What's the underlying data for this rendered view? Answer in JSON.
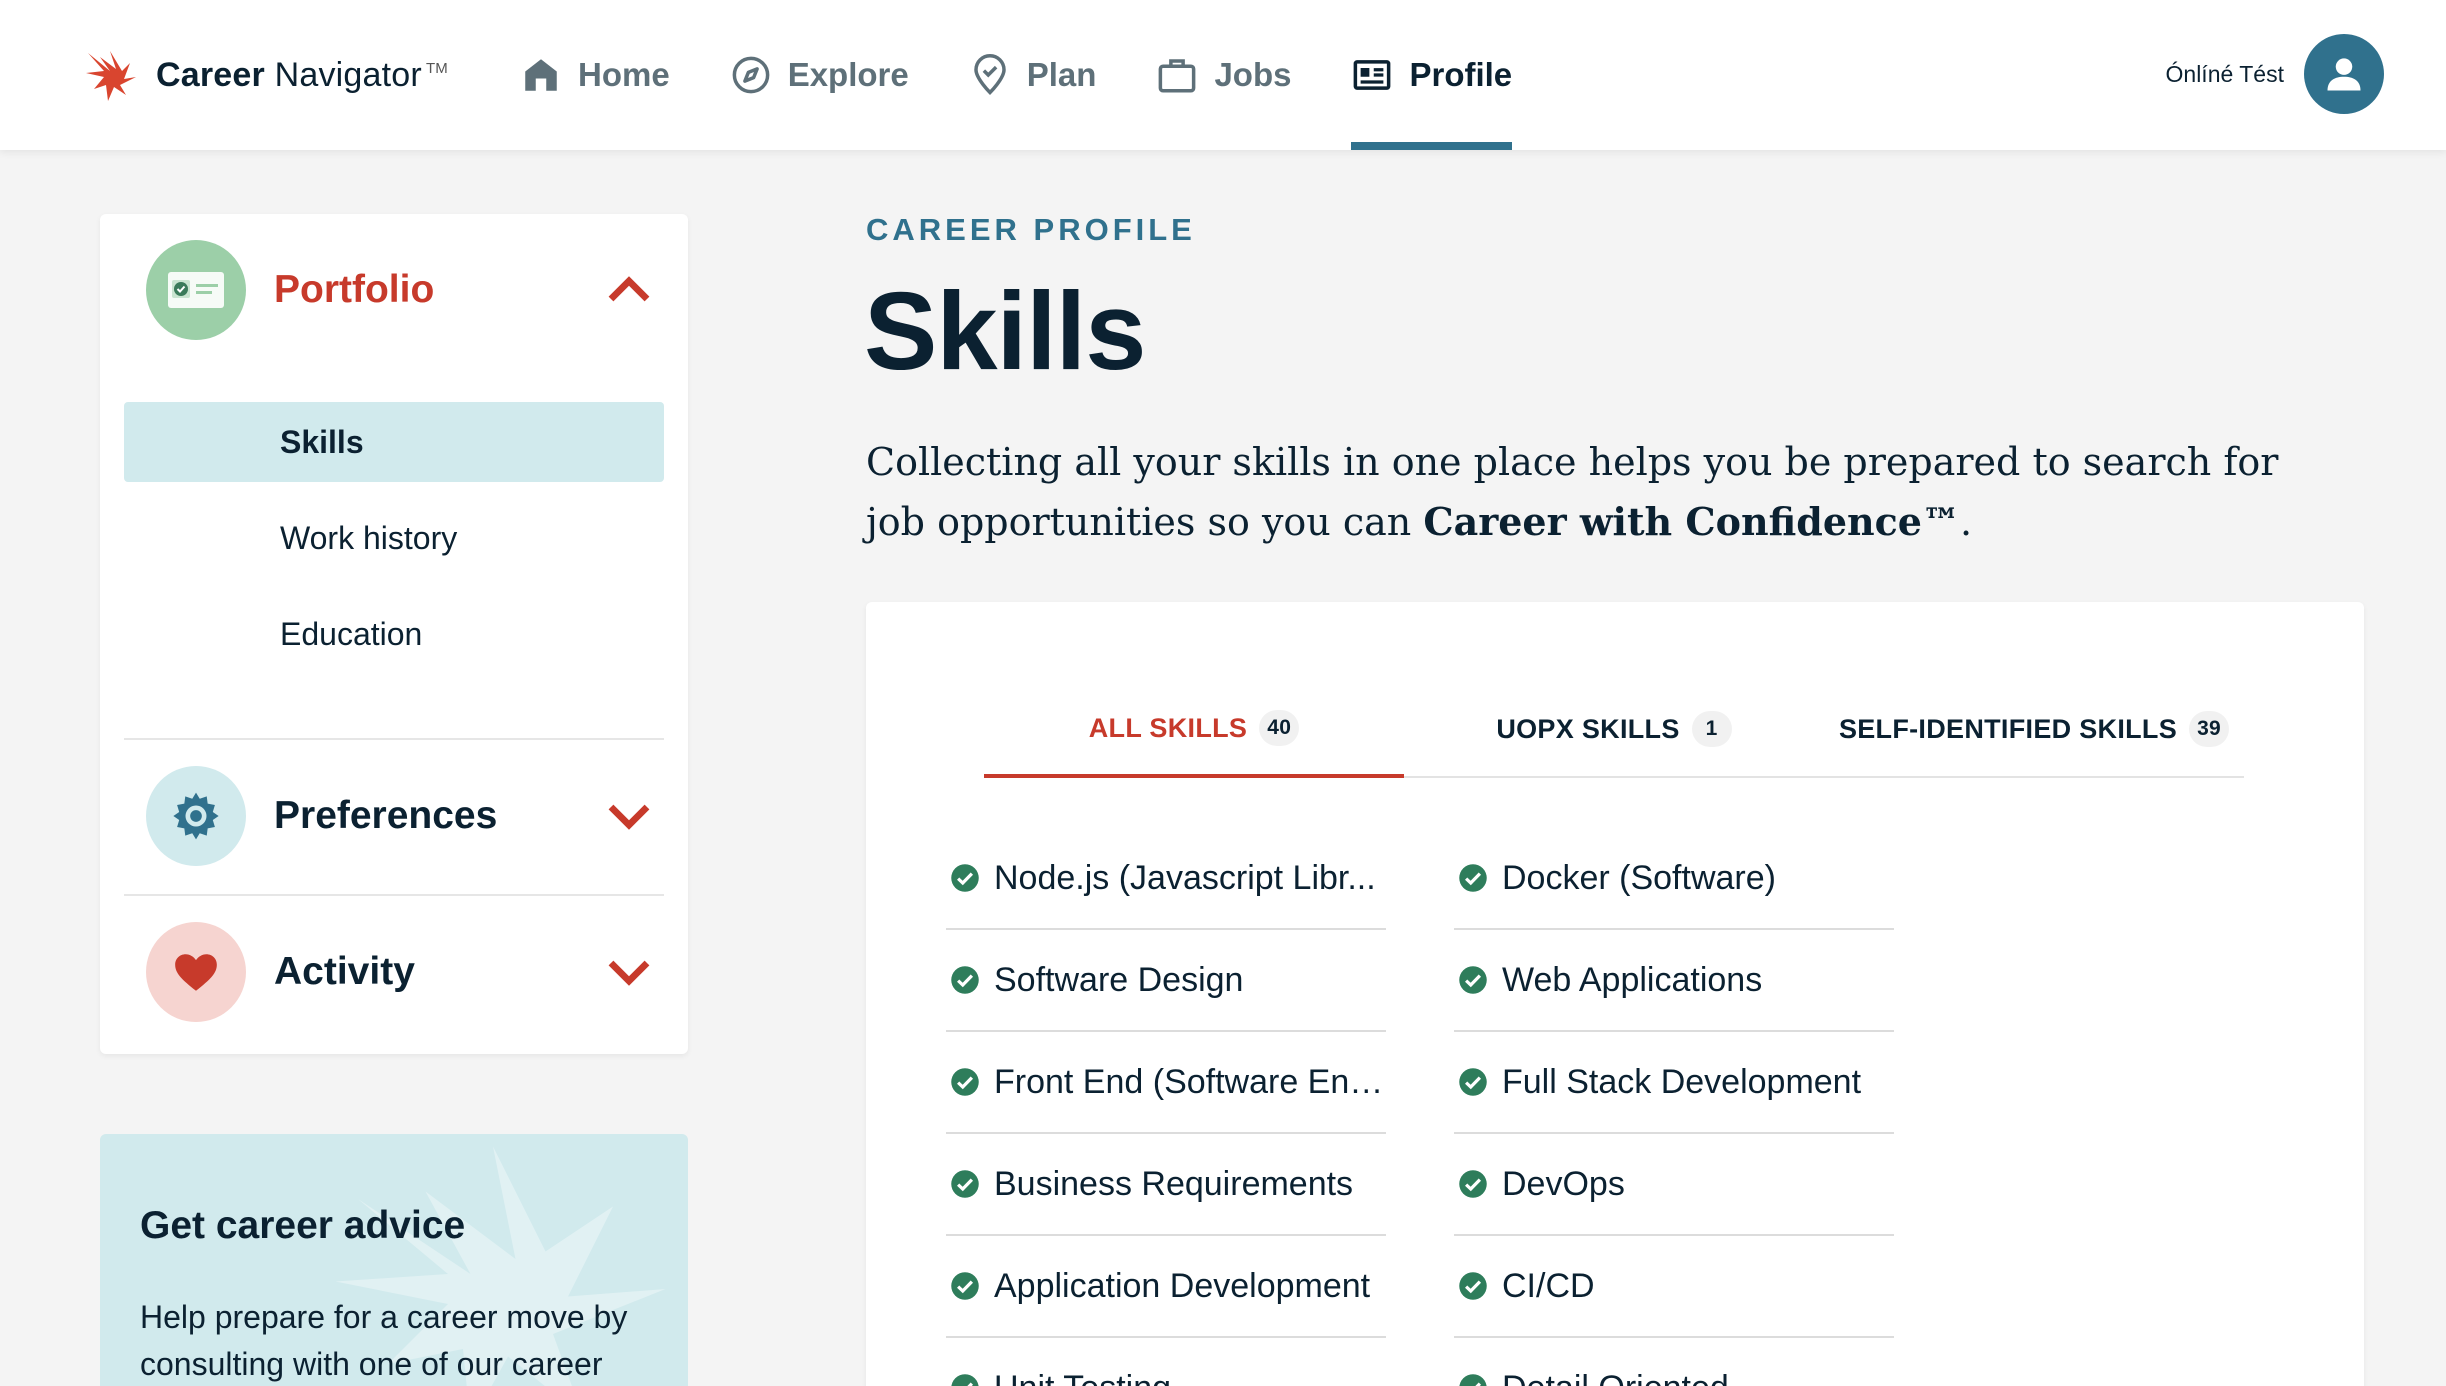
{
  "header": {
    "brand_bold": "Career",
    "brand_rest": "Navigator",
    "brand_tm": "TM",
    "nav": [
      {
        "label": "Home",
        "icon": "home-icon"
      },
      {
        "label": "Explore",
        "icon": "compass-icon"
      },
      {
        "label": "Plan",
        "icon": "map-pin-check-icon"
      },
      {
        "label": "Jobs",
        "icon": "briefcase-icon"
      },
      {
        "label": "Profile",
        "icon": "id-card-icon"
      }
    ],
    "active_nav": "Profile",
    "user_name": "Ónlíné Tést"
  },
  "sidebar": {
    "portfolio": {
      "title": "Portfolio",
      "items": [
        "Skills",
        "Work history",
        "Education"
      ],
      "active_item": "Skills"
    },
    "preferences": {
      "title": "Preferences"
    },
    "activity": {
      "title": "Activity"
    },
    "advice": {
      "title": "Get career advice",
      "text": "Help prepare for a career move by consulting with one of our career"
    }
  },
  "main": {
    "eyebrow": "CAREER PROFILE",
    "title": "Skills",
    "intro_plain": "Collecting all your skills in one place helps you be prepared to search for job opportunities so you can ",
    "intro_bold": "Career with Confidence™",
    "intro_end": "."
  },
  "tabs": [
    {
      "label": "ALL SKILLS",
      "count": "40"
    },
    {
      "label": "UOPX SKILLS",
      "count": "1"
    },
    {
      "label": "SELF-IDENTIFIED SKILLS",
      "count": "39"
    }
  ],
  "skills_left": [
    "Node.js (Javascript Libr...",
    "Software Design",
    "Front End (Software Eng...",
    "Business Requirements",
    "Application Development",
    "Unit Testing"
  ],
  "skills_right": [
    "Docker (Software)",
    "Web Applications",
    "Full Stack Development",
    "DevOps",
    "CI/CD",
    "Detail Oriented"
  ],
  "colors": {
    "accent_red": "#c73a2b",
    "brand_blue": "#30718d",
    "check_green": "#2e7d5b",
    "highlight": "#d1eaed"
  }
}
